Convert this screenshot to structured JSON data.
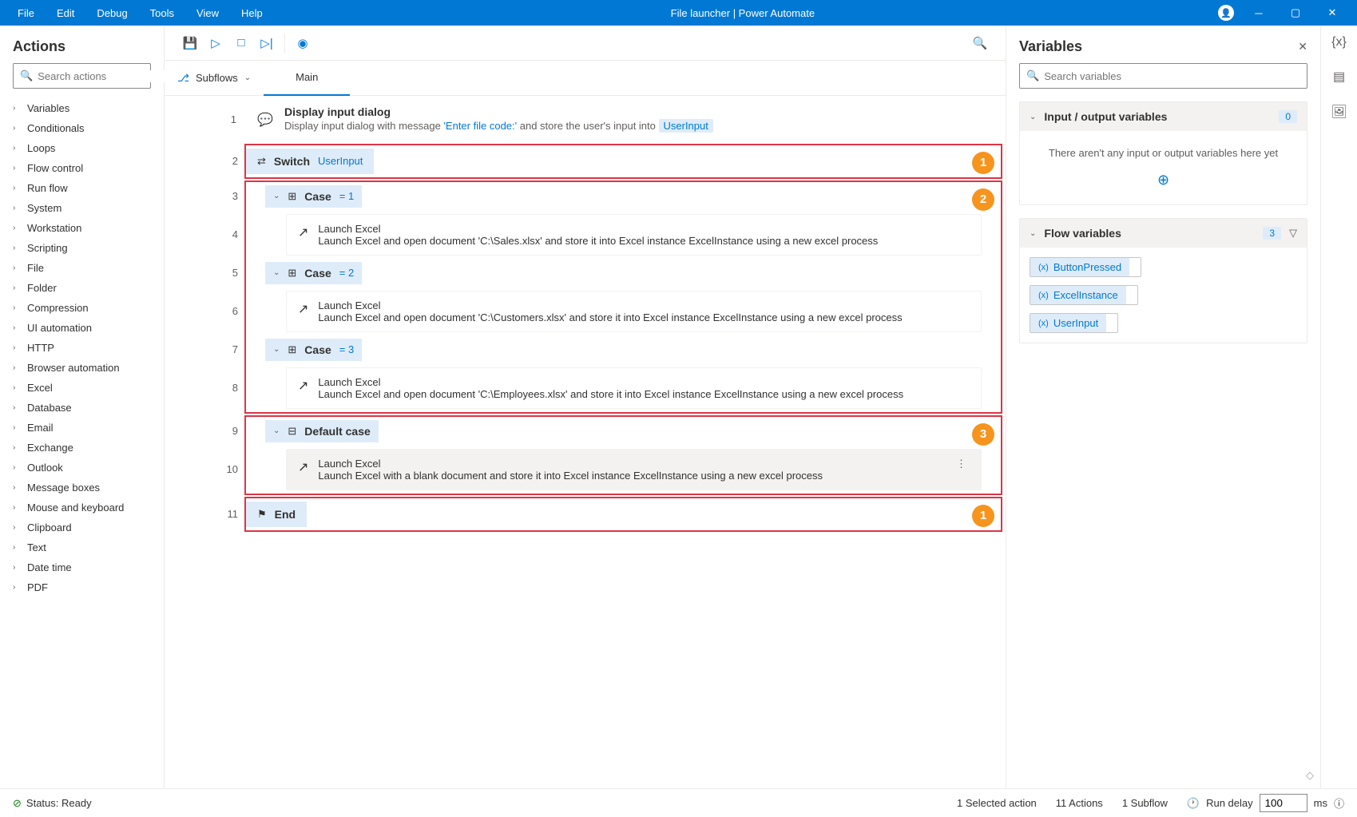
{
  "titlebar": {
    "menu": [
      "File",
      "Edit",
      "Debug",
      "Tools",
      "View",
      "Help"
    ],
    "title": "File launcher | Power Automate"
  },
  "actions_panel": {
    "heading": "Actions",
    "search_placeholder": "Search actions",
    "categories": [
      "Variables",
      "Conditionals",
      "Loops",
      "Flow control",
      "Run flow",
      "System",
      "Workstation",
      "Scripting",
      "File",
      "Folder",
      "Compression",
      "UI automation",
      "HTTP",
      "Browser automation",
      "Excel",
      "Database",
      "Email",
      "Exchange",
      "Outlook",
      "Message boxes",
      "Mouse and keyboard",
      "Clipboard",
      "Text",
      "Date time",
      "PDF"
    ]
  },
  "toolbar": {},
  "subflows": {
    "label": "Subflows",
    "tab": "Main"
  },
  "steps": {
    "s1": {
      "title": "Display input dialog",
      "d1": "Display input dialog with message ",
      "str1": "'Enter file code:'",
      "d2": " and store the user's input into ",
      "var1": "UserInput"
    },
    "switch": {
      "title": "Switch",
      "var": "UserInput"
    },
    "case1": {
      "title": "Case",
      "val": "= 1"
    },
    "s4": {
      "title": "Launch Excel",
      "d1": "Launch Excel and open document ",
      "str1": "'C:\\Sales.xlsx'",
      "d2": " and store it into Excel instance ",
      "var1": "ExcelInstance",
      "d3": " using a new excel process"
    },
    "case2": {
      "title": "Case",
      "val": "= 2"
    },
    "s6": {
      "title": "Launch Excel",
      "d1": "Launch Excel and open document ",
      "str1": "'C:\\Customers.xlsx'",
      "d2": " and store it into Excel instance ",
      "var1": "ExcelInstance",
      "d3": " using a new excel process"
    },
    "case3": {
      "title": "Case",
      "val": "= 3"
    },
    "s8": {
      "title": "Launch Excel",
      "d1": "Launch Excel and open document ",
      "str1": "'C:\\Employees.xlsx'",
      "d2": " and store it into Excel instance ",
      "var1": "ExcelInstance",
      "d3": " using a new excel process"
    },
    "default": {
      "title": "Default case"
    },
    "s10": {
      "title": "Launch Excel",
      "d1": "Launch Excel with a blank document and store it into Excel instance ",
      "var1": "ExcelInstance",
      "d2": " using a new excel process"
    },
    "end": {
      "title": "End"
    },
    "lines": {
      "l1": "1",
      "l2": "2",
      "l3": "3",
      "l4": "4",
      "l5": "5",
      "l6": "6",
      "l7": "7",
      "l8": "8",
      "l9": "9",
      "l10": "10",
      "l11": "11"
    },
    "badges": {
      "b1": "1",
      "b2": "2",
      "b3": "3"
    }
  },
  "variables_panel": {
    "heading": "Variables",
    "search_placeholder": "Search variables",
    "io": {
      "title": "Input / output variables",
      "count": "0",
      "empty": "There aren't any input or output variables here yet"
    },
    "flow": {
      "title": "Flow variables",
      "count": "3",
      "items": [
        "ButtonPressed",
        "ExcelInstance",
        "UserInput"
      ]
    }
  },
  "statusbar": {
    "status": "Status: Ready",
    "selected": "1 Selected action",
    "actions": "11 Actions",
    "subflows": "1 Subflow",
    "delay_label": "Run delay",
    "delay_value": "100",
    "delay_unit": "ms"
  }
}
